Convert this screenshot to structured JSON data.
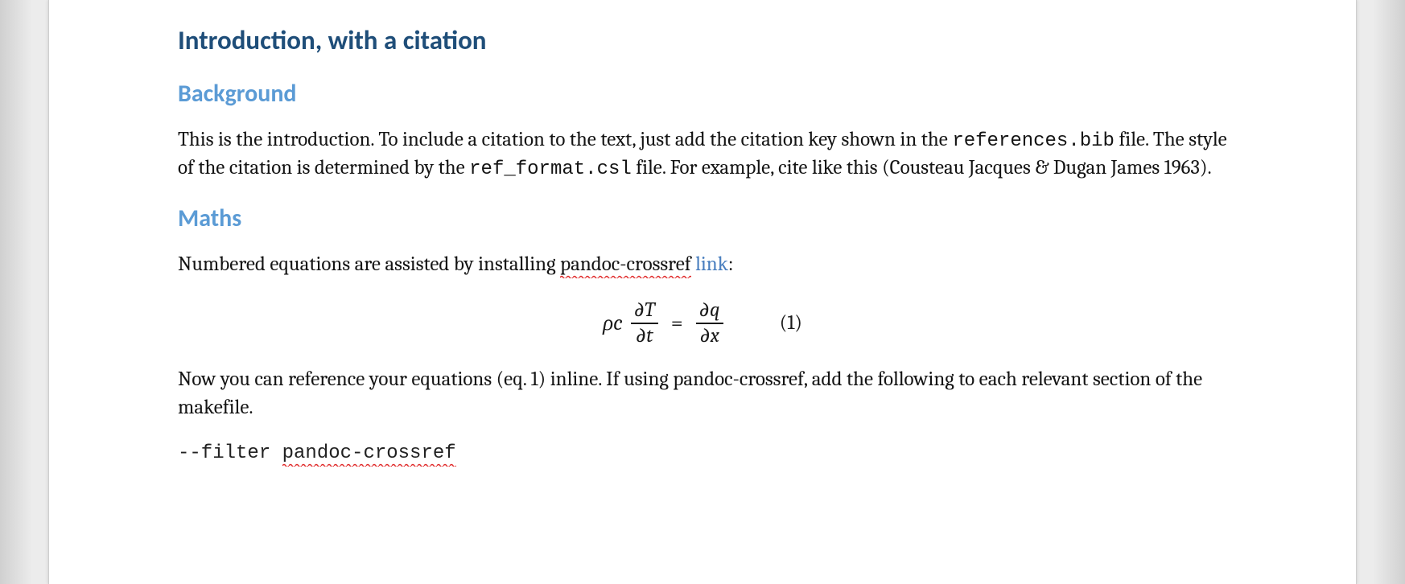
{
  "headings": {
    "h1": "Introduction, with a citation",
    "h2a": "Background",
    "h2b": "Maths"
  },
  "background_para": {
    "t1": "This is the introduction. To include a citation to the text, just add the citation key shown in the ",
    "file1": "references.bib",
    "t2": " file. The style of the citation is determined by the ",
    "file2": "ref_format.csl",
    "t3": " file. For example, cite like this (Cousteau Jacques & Dugan James 1963)."
  },
  "maths_para1": {
    "t1": "Numbered equations are assisted by installing ",
    "sq1": "pandoc-crossref",
    "space": " ",
    "link": "link",
    "t2": ":"
  },
  "equation": {
    "lhs_coeff": "ρc",
    "frac1_num": "∂T",
    "frac1_den": "∂t",
    "eq_sign": "=",
    "frac2_num": "∂q",
    "frac2_den": "∂x",
    "number": "(1)"
  },
  "maths_para2": "Now you can reference your equations (eq. 1) inline. If using pandoc-crossref, add the following to each relevant section of the makefile.",
  "code_line": {
    "prefix": "--filter ",
    "sq": "pandoc-crossref"
  }
}
